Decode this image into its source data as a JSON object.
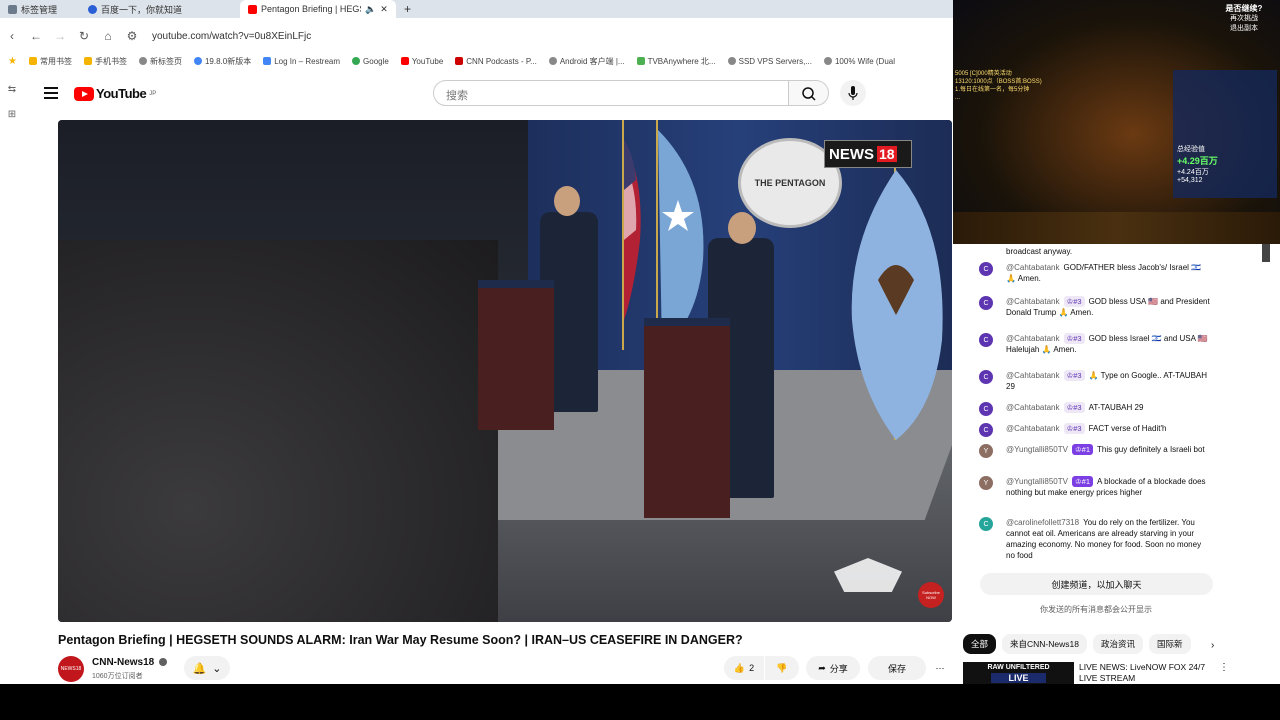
{
  "browser": {
    "tabs": [
      {
        "label": "标签管理",
        "color": "#6b7b8c"
      },
      {
        "label": "百度一下，你就知道",
        "color": "#2a5fd6"
      },
      {
        "label": "Pentagon Briefing | HEGS",
        "color": "#ff0000",
        "active": true
      }
    ],
    "new_tab_label": "+",
    "url": "youtube.com/watch?v=0u8XEinLFjc",
    "bookmarks": [
      {
        "label": "常用书签",
        "color": "#f4b400"
      },
      {
        "label": "手机书签",
        "color": "#f4b400"
      },
      {
        "label": "新标签页",
        "color": "#888888"
      },
      {
        "label": "19.8.0新版本",
        "color": "#4285f4"
      },
      {
        "label": "Log In – Restream",
        "color": "#4285f4"
      },
      {
        "label": "Google",
        "color": "#34a853"
      },
      {
        "label": "YouTube",
        "color": "#ff0000"
      },
      {
        "label": "CNN Podcasts - P...",
        "color": "#cc0000"
      },
      {
        "label": "Android 客户端 |...",
        "color": "#888888"
      },
      {
        "label": "TVBAnywhere 北...",
        "color": "#4caf50"
      },
      {
        "label": "SSD VPS Servers,...",
        "color": "#888888"
      },
      {
        "label": "100% Wife (Dual",
        "color": "#888888"
      }
    ]
  },
  "youtube": {
    "logo_text": "YouTube",
    "logo_region": "JP",
    "search_placeholder": "搜索",
    "video": {
      "title": "Pentagon Briefing | HEGSETH SOUNDS ALARM: Iran War May Resume Soon? | IRAN–US CEASEFIRE IN DANGER?",
      "overlay_logo_word": "NEWS",
      "overlay_logo_num": "18",
      "seal_text": "THE PENTAGON",
      "subscribe_badge": "Subscribe NOW"
    },
    "channel": {
      "name": "CNN-News18",
      "subscribers": "1060万位订阅者",
      "avatar_text": "NEWS18"
    },
    "actions": {
      "like_count": "2",
      "share_label": "分享",
      "save_label": "保存"
    }
  },
  "stream_overlay": {
    "top_right_lines": [
      "是否继续?",
      "再次挑战",
      "退出副本"
    ],
    "panel_lines": [
      "总经验值",
      "+4.29百万",
      "+4.24百万",
      "+54,312"
    ],
    "left_lines": [
      "5005 [C]000精英活动",
      "13120:1000点（BOSS首:BOSS)",
      "1.每日在线第一名，每5分钟",
      "..."
    ]
  },
  "chat": {
    "first_line": "broadcast anyway.",
    "messages": [
      {
        "author": "@Cahtabatank",
        "badge": "",
        "text": "GOD/FATHER bless Jacob's/ Israel 🇮🇱 🙏 Amen.",
        "avatar": "C",
        "color": "#5e35b1"
      },
      {
        "author": "@Cahtabatank",
        "badge": "♔#3",
        "text": "GOD bless USA 🇺🇸 and President Donald Trump 🙏 Amen.",
        "avatar": "C",
        "color": "#5e35b1"
      },
      {
        "author": "@Cahtabatank",
        "badge": "♔#3",
        "text": "GOD bless Israel 🇮🇱 and USA 🇺🇸 Halelujah 🙏 Amen.",
        "avatar": "C",
        "color": "#5e35b1"
      },
      {
        "author": "@Cahtabatank",
        "badge": "♔#3",
        "text": "🙏 Type on Google.. AT-TAUBAH 29",
        "avatar": "C",
        "color": "#5e35b1"
      },
      {
        "author": "@Cahtabatank",
        "badge": "♔#3",
        "text": "AT-TAUBAH 29",
        "avatar": "C",
        "color": "#5e35b1"
      },
      {
        "author": "@Cahtabatank",
        "badge": "♔#3",
        "text": "FACT verse of Hadit'h",
        "avatar": "C",
        "color": "#5e35b1"
      },
      {
        "author": "@Yungtalli850TV",
        "badge": "♔#1",
        "text": "This guy definitely a Israeli bot",
        "avatar": "Y",
        "color": "#8d6e63",
        "hot": true
      },
      {
        "author": "@Yungtalli850TV",
        "badge": "♔#1",
        "text": "A blockade of a blockade does nothing but make energy prices higher",
        "avatar": "Y",
        "color": "#8d6e63",
        "hot": true
      },
      {
        "author": "@carolinefollett7318",
        "badge": "",
        "text": "You do rely on the fertilizer. You cannot eat oil. Americans are already starving in your amazing economy. No money for food. Soon no money no food",
        "avatar": "C",
        "color": "#26a69a"
      }
    ],
    "create_channel_label": "创建频道，以加入聊天",
    "public_note": "你发送的所有消息都会公开显示"
  },
  "recommendations": {
    "chips": [
      "全部",
      "来自CNN-News18",
      "政治资讯",
      "国际新"
    ],
    "item": {
      "thumb_line1": "RAW UNFILTERED",
      "thumb_line2": "LIVE",
      "title": "LIVE NEWS: LiveNOW FOX 24/7 LIVE STREAM"
    }
  }
}
